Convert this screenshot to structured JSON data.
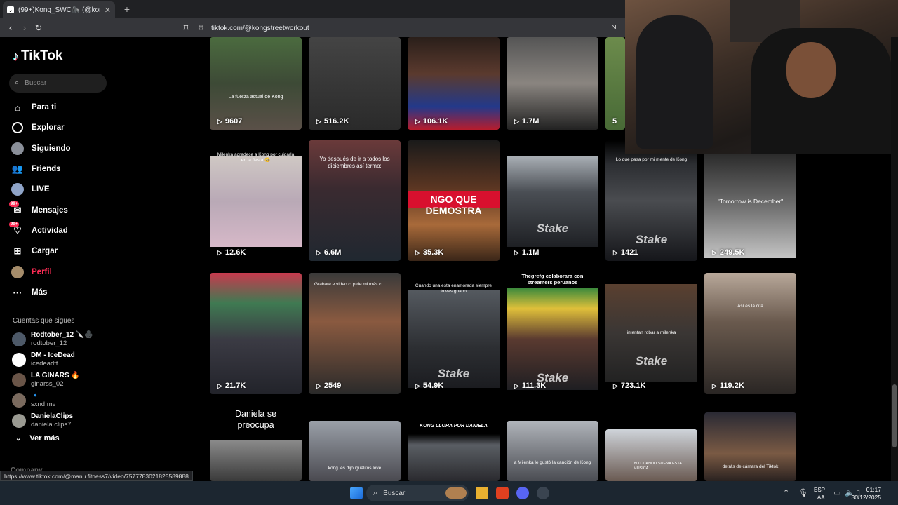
{
  "browser": {
    "tab_title": "(99+)Kong_SWC🦍 (@kongstre",
    "tab_close": "✕",
    "new_tab": "+",
    "url": "tiktok.com/@kongstreetworkout",
    "status_url": "https://www.tiktok.com/@manu.fitness7/video/7577783021825589888"
  },
  "sidebar": {
    "logo": "TikTok",
    "search_placeholder": "Buscar",
    "nav": [
      {
        "label": "Para ti"
      },
      {
        "label": "Explorar"
      },
      {
        "label": "Siguiendo"
      },
      {
        "label": "Friends"
      },
      {
        "label": "LIVE"
      },
      {
        "label": "Mensajes",
        "badge": "99+"
      },
      {
        "label": "Actividad",
        "badge": "99+"
      },
      {
        "label": "Cargar"
      },
      {
        "label": "Perfil"
      },
      {
        "label": "Más"
      }
    ],
    "following_header": "Cuentas que sigues",
    "following": [
      {
        "name": "Rodtober_12 🔪♣️",
        "handle": "rodtober_12"
      },
      {
        "name": "DM - IceDead",
        "handle": "icedeadtt"
      },
      {
        "name": "LA GINARS 🔥",
        "handle": "ginarss_02"
      },
      {
        "name": "🔹",
        "handle": "sxnd.mv"
      },
      {
        "name": "DanielaClips",
        "handle": "daniela.clips7"
      }
    ],
    "see_more": "Ver más",
    "company": "Company"
  },
  "grid": {
    "row1": [
      "9607",
      "516.2K",
      "106.1K",
      "1.7M",
      "5"
    ],
    "row1_caption": "La fuerza actual de Kong",
    "row2": [
      {
        "views": "12.6K",
        "caption": "Milenka agradece a Kong por cuidarla en la fiesta 🥺"
      },
      {
        "views": "6.6M",
        "caption": "Yo después de ir a todos los diciembres así termo:"
      },
      {
        "views": "35.3K",
        "caption": "NGO QUE DEMOSTRA"
      },
      {
        "views": "1.1M",
        "caption": "Stake"
      },
      {
        "views": "1421",
        "caption": "Lo que pasa por mi mente de Kong"
      },
      {
        "views": "249.5K",
        "caption": "\"Tomorrow is December\""
      }
    ],
    "row3": [
      {
        "views": "21.7K",
        "caption": ""
      },
      {
        "views": "2549",
        "caption": "Grabaré e video cl p de mi más c"
      },
      {
        "views": "54.9K",
        "caption": "Cuando una esta enamorada siempre lo ves guapo"
      },
      {
        "views": "111.3K",
        "caption": "Thegrefg colaborara con streamers peruanos"
      },
      {
        "views": "723.1K",
        "caption": "intentan robar a milenka"
      },
      {
        "views": "119.2K",
        "caption": "Así es la cita"
      }
    ],
    "row4": [
      {
        "caption": "Daniela se preocupa"
      },
      {
        "caption": "kong les dijo igualitos love"
      },
      {
        "caption": "KONG LLORA POR DANIELA"
      },
      {
        "caption": "a Milenka le gustó la canción de Kong"
      },
      {
        "caption": "YO CUANDO SUENA ESTA MÚSICA"
      },
      {
        "caption": "detrás de cámara del Tiktok"
      }
    ]
  },
  "taskbar": {
    "search": "Buscar",
    "lang1": "ESP",
    "lang2": "LAA",
    "time": "01:17",
    "date": "30/12/2025"
  },
  "colors": {
    "accent": "#fe2c55",
    "background": "#000000"
  }
}
